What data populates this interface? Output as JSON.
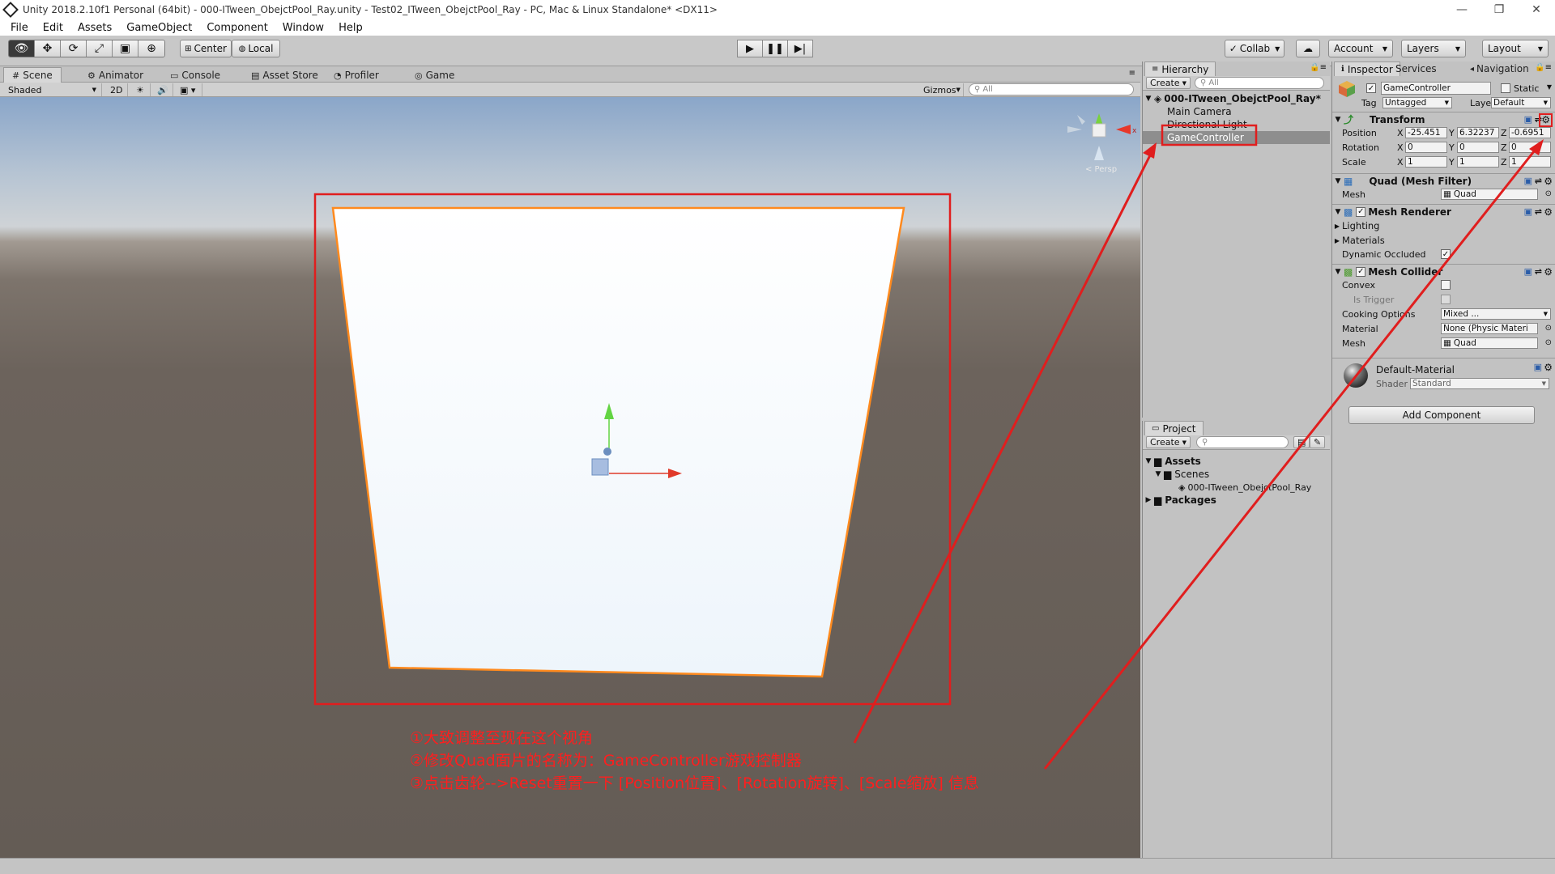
{
  "window": {
    "title": "Unity 2018.2.10f1 Personal (64bit) - 000-ITween_ObejctPool_Ray.unity - Test02_ITween_ObejctPool_Ray - PC, Mac & Linux Standalone* <DX11>",
    "controls": [
      "—",
      "❐",
      "✕"
    ]
  },
  "menu": [
    "File",
    "Edit",
    "Assets",
    "GameObject",
    "Component",
    "Window",
    "Help"
  ],
  "toolbar": {
    "pivot": "Center",
    "space": "Local",
    "collab": "Collab",
    "account": "Account",
    "layers": "Layers",
    "layout": "Layout"
  },
  "scene": {
    "tabs": [
      "Scene",
      "Animator",
      "Console",
      "Asset Store",
      "Profiler",
      "Game"
    ],
    "shading": "Shaded",
    "mode_2d": "2D",
    "gizmos": "Gizmos",
    "search_placeholder": "All",
    "persp_label": "< Persp"
  },
  "hierarchy": {
    "tab": "Hierarchy",
    "create": "Create",
    "search_placeholder": "All",
    "scene_name": "000-ITween_ObejctPool_Ray*",
    "items": [
      "Main Camera",
      "Directional Light",
      "GameController"
    ],
    "selected_index": 2
  },
  "project": {
    "tab": "Project",
    "create": "Create",
    "tree": {
      "assets": "Assets",
      "scenes": "Scenes",
      "scene_file": "000-ITween_ObejctPool_Ray",
      "packages": "Packages"
    }
  },
  "inspector": {
    "tabs": [
      "Inspector",
      "Services",
      "Navigation"
    ],
    "object_name": "GameController",
    "static_label": "Static",
    "tag_label": "Tag",
    "tag_value": "Untagged",
    "layer_label": "Layer",
    "layer_value": "Default",
    "transform": {
      "title": "Transform",
      "position_label": "Position",
      "rotation_label": "Rotation",
      "scale_label": "Scale",
      "position": [
        "-25.451",
        "6.32237",
        "-0.6951"
      ],
      "rotation": [
        "0",
        "0",
        "0"
      ],
      "scale": [
        "1",
        "1",
        "1"
      ],
      "axes": [
        "X",
        "Y",
        "Z"
      ]
    },
    "mesh_filter": {
      "title": "Quad (Mesh Filter)",
      "mesh_label": "Mesh",
      "mesh_value": "Quad"
    },
    "mesh_renderer": {
      "title": "Mesh Renderer",
      "lighting": "Lighting",
      "materials": "Materials",
      "dynamic_occluded": "Dynamic Occluded"
    },
    "mesh_collider": {
      "title": "Mesh Collider",
      "convex": "Convex",
      "is_trigger": "Is Trigger",
      "cooking_options": "Cooking Options",
      "cooking_value": "Mixed ...",
      "material_label": "Material",
      "material_value": "None (Physic Materi",
      "mesh_label": "Mesh",
      "mesh_value": "Quad"
    },
    "material": {
      "name": "Default-Material",
      "shader_label": "Shader",
      "shader_value": "Standard"
    },
    "add_component": "Add Component"
  },
  "annotations": [
    "①大致调整至现在这个视角",
    "②修改Quad面片的名称为：GameController游戏控制器",
    "③点击齿轮-->Reset重置一下 [Position位置]、[Rotation旋转]、[Scale缩放] 信息"
  ],
  "colors": {
    "annotation": "#ff1e1e",
    "selection": "#3d8cd8",
    "quad_outline": "#ff8a1e"
  }
}
